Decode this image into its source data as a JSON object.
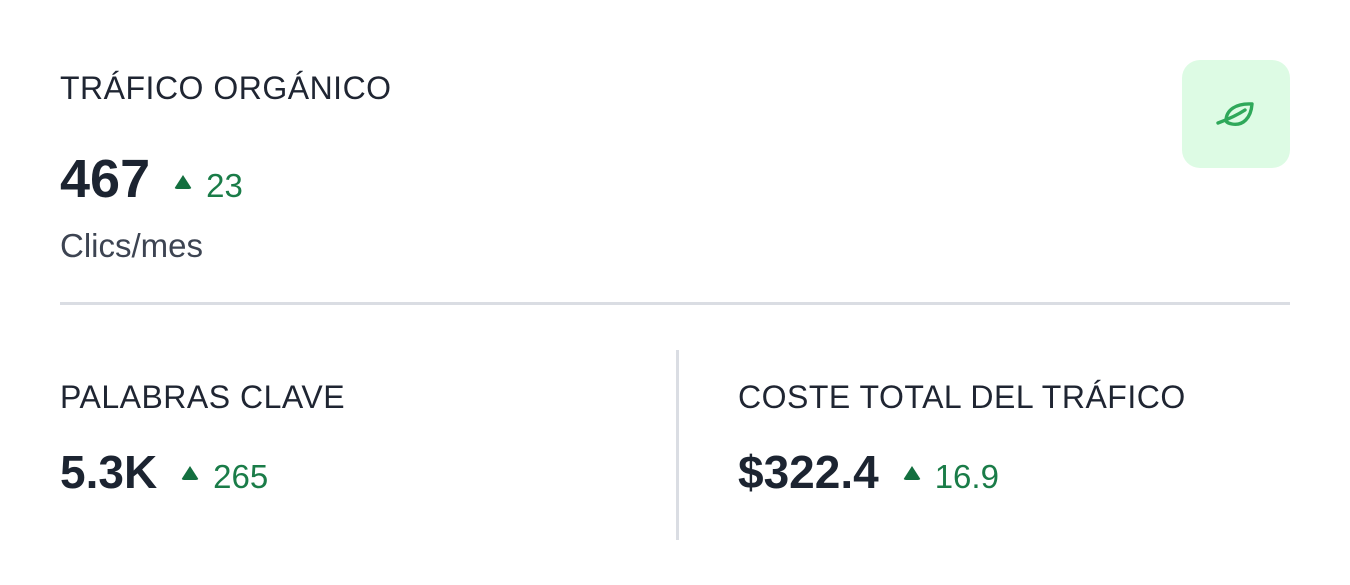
{
  "organic": {
    "title": "TRÁFICO ORGÁNICO",
    "value": "467",
    "delta": "23",
    "unit": "Clics/mes",
    "icon": "leaf-icon"
  },
  "keywords": {
    "title": "PALABRAS CLAVE",
    "value": "5.3K",
    "delta": "265"
  },
  "cost": {
    "title": "COSTE TOTAL DEL TRÁFICO",
    "value": "$322.4",
    "delta": "16.9"
  },
  "colors": {
    "positive": "#1a7c48",
    "badge_bg": "#ddfbe4",
    "leaf_stroke": "#2fa85a",
    "divider": "#dadde3",
    "text": "#1f2532"
  }
}
